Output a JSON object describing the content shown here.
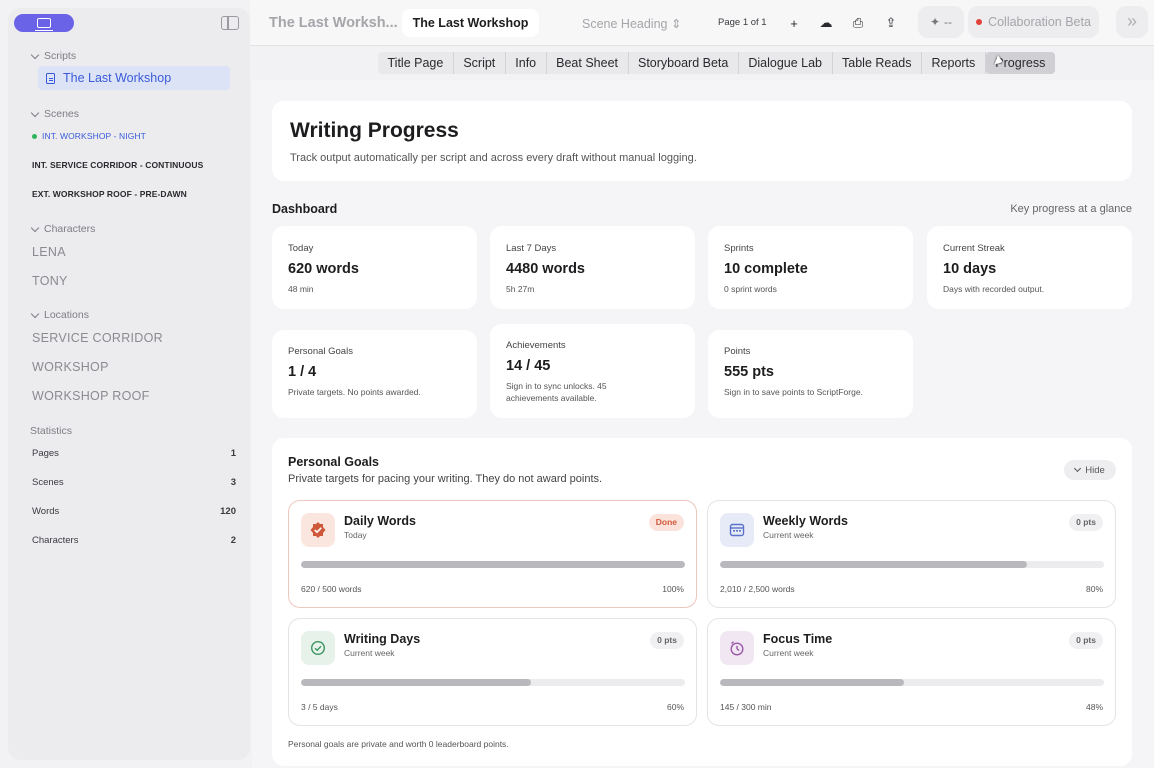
{
  "sidebar": {
    "scripts_header": "Scripts",
    "script_item": "The Last Workshop",
    "scenes_header": "Scenes",
    "scenes": [
      "INT. WORKSHOP - NIGHT",
      "INT. SERVICE CORRIDOR - CONTINUOUS",
      "EXT. WORKSHOP ROOF - PRE-DAWN"
    ],
    "characters_header": "Characters",
    "characters": [
      "LENA",
      "TONY"
    ],
    "locations_header": "Locations",
    "locations": [
      "SERVICE CORRIDOR",
      "WORKSHOP",
      "WORKSHOP ROOF"
    ],
    "statistics_header": "Statistics",
    "stats": [
      {
        "label": "Pages",
        "value": "1"
      },
      {
        "label": "Scenes",
        "value": "3"
      },
      {
        "label": "Words",
        "value": "120"
      },
      {
        "label": "Characters",
        "value": "2"
      }
    ]
  },
  "topbar": {
    "title_dim": "The Last Worksh...",
    "title": "The Last Workshop",
    "scene_select": "Scene Heading",
    "page": "Page 1 of 1",
    "wand_label": "--",
    "collab": "Collaboration Beta"
  },
  "tabs": [
    "Title Page",
    "Script",
    "Info",
    "Beat Sheet",
    "Storyboard Beta",
    "Dialogue Lab",
    "Table Reads",
    "Reports",
    "Progress"
  ],
  "hero": {
    "title": "Writing Progress",
    "subtitle": "Track output automatically per script and across every draft without manual logging."
  },
  "dashboard": {
    "title": "Dashboard",
    "right": "Key progress at a glance",
    "cards": [
      {
        "label": "Today",
        "value": "620 words",
        "note": "48 min"
      },
      {
        "label": "Last 7 Days",
        "value": "4480 words",
        "note": "5h 27m"
      },
      {
        "label": "Sprints",
        "value": "10 complete",
        "note": "0 sprint words"
      },
      {
        "label": "Current Streak",
        "value": "10 days",
        "note": "Days with recorded output."
      },
      {
        "label": "Personal Goals",
        "value": "1 / 4",
        "note": "Private targets. No points awarded."
      },
      {
        "label": "Achievements",
        "value": "14 / 45",
        "note": "Sign in to sync unlocks. 45 achievements available."
      },
      {
        "label": "Points",
        "value": "555 pts",
        "note": "Sign in to save points to ScriptForge."
      }
    ]
  },
  "personal_goals": {
    "title": "Personal Goals",
    "subtitle": "Private targets for pacing your writing. They do not award points.",
    "hide": "Hide",
    "goals": [
      {
        "name": "Daily Words",
        "period": "Today",
        "badge": "Done",
        "progress_text": "620 / 500 words",
        "pct_text": "100%",
        "fraction": 1.0
      },
      {
        "name": "Weekly Words",
        "period": "Current week",
        "badge": "0 pts",
        "progress_text": "2,010 / 2,500 words",
        "pct_text": "80%",
        "fraction": 0.8
      },
      {
        "name": "Writing Days",
        "period": "Current week",
        "badge": "0 pts",
        "progress_text": "3 / 5 days",
        "pct_text": "60%",
        "fraction": 0.6
      },
      {
        "name": "Focus Time",
        "period": "Current week",
        "badge": "0 pts",
        "progress_text": "145 / 300 min",
        "pct_text": "48%",
        "fraction": 0.48
      }
    ],
    "footnote": "Personal goals are private and worth 0 leaderboard points."
  },
  "colors": {
    "accent": "#6a63e8",
    "done": "#d0583a",
    "link": "#3a5bd9"
  }
}
